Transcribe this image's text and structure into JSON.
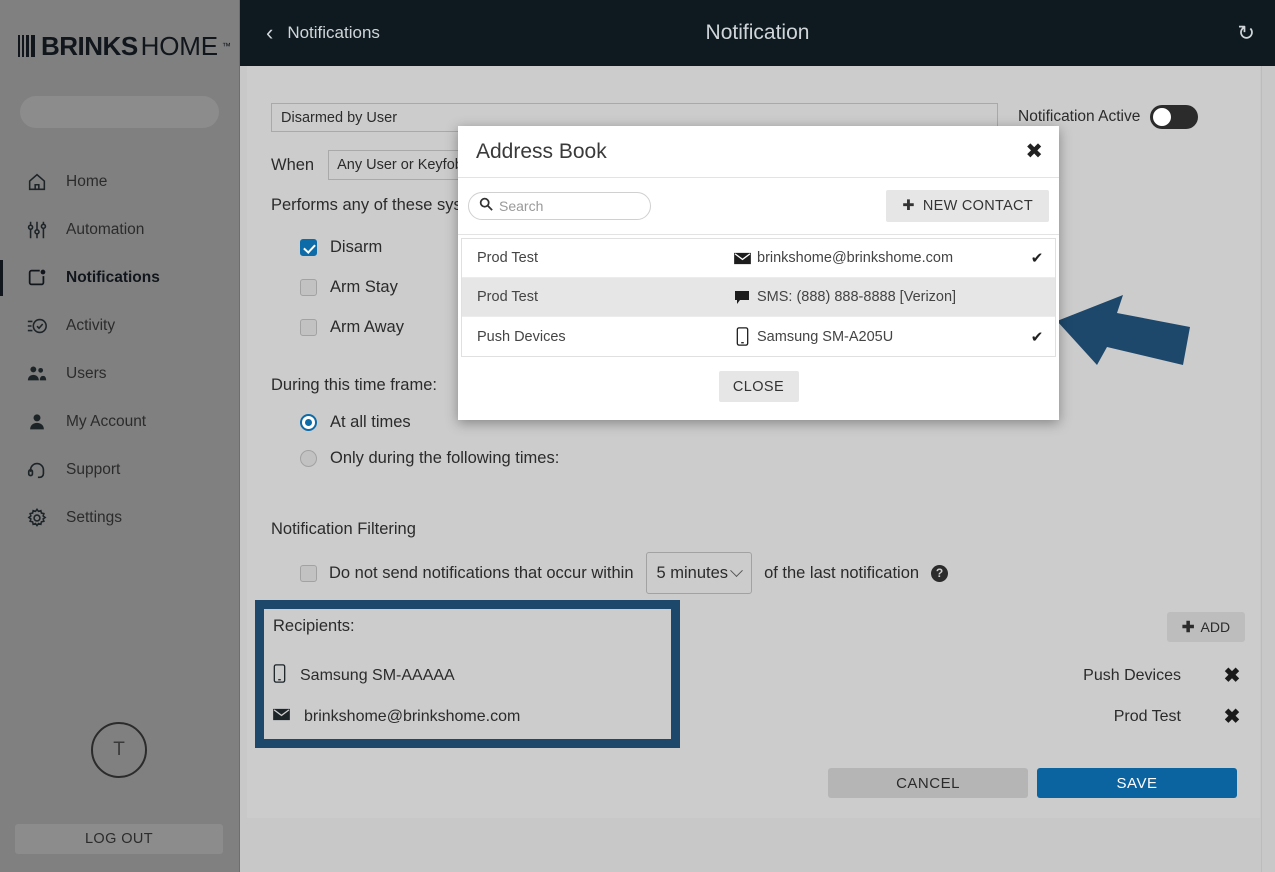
{
  "colors": {
    "sidebar_bg": "#808080",
    "header_bg": "#0e1a20",
    "panel_bg": "#cccccc",
    "accent_blue": "#0b639f",
    "checkbox_blue": "#0d6ba8",
    "annotation_navy": "#1e486b"
  },
  "sidebar": {
    "logo": {
      "brand": "BRINKS",
      "product": "HOME",
      "trademark": "™"
    },
    "items": [
      {
        "label": "Home",
        "icon": "home-icon",
        "active": false
      },
      {
        "label": "Automation",
        "icon": "sliders-icon",
        "active": false
      },
      {
        "label": "Notifications",
        "icon": "notification-icon",
        "active": true
      },
      {
        "label": "Activity",
        "icon": "activity-check-icon",
        "active": false
      },
      {
        "label": "Users",
        "icon": "users-icon",
        "active": false
      },
      {
        "label": "My Account",
        "icon": "person-icon",
        "active": false
      },
      {
        "label": "Support",
        "icon": "headset-icon",
        "active": false
      },
      {
        "label": "Settings",
        "icon": "gear-icon",
        "active": false
      }
    ],
    "avatar_initial": "T",
    "logout_label": "LOG OUT"
  },
  "header": {
    "back_label": "Notifications",
    "title": "Notification",
    "back_icon": "chevron-left-icon",
    "refresh_icon": "refresh-icon"
  },
  "form": {
    "name_value": "Disarmed by User",
    "toggle_label": "Notification Active",
    "toggle_state": "off",
    "when_label": "When",
    "when_value": "Any User or Keyfob",
    "performs_label": "Performs any of these system actions:",
    "actions": [
      {
        "label": "Disarm",
        "checked": true
      },
      {
        "label": "Arm Stay",
        "checked": false
      },
      {
        "label": "Arm Away",
        "checked": false
      }
    ],
    "timeframe_label": "During this time frame:",
    "timeframe_options": [
      {
        "label": "At all times",
        "selected": true
      },
      {
        "label": "Only during the following times:",
        "selected": false
      }
    ],
    "filtering_label": "Notification Filtering",
    "filter_checkbox_checked": false,
    "filter_text_before": "Do not send notifications that occur within",
    "filter_interval": "5 minutes",
    "filter_text_after": "of the last notification",
    "help_icon": "help-icon"
  },
  "recipients": {
    "title": "Recipients:",
    "add_label": "ADD",
    "add_icon": "plus-icon",
    "rows": [
      {
        "icon": "mobile-icon",
        "value": "Samsung SM-AAAAA",
        "type": "Push Devices",
        "remove_icon": "close-x-icon"
      },
      {
        "icon": "envelope-icon",
        "value": "brinkshome@brinkshome.com",
        "type": "Prod Test",
        "remove_icon": "close-x-icon"
      }
    ]
  },
  "footer": {
    "cancel_label": "CANCEL",
    "save_label": "SAVE"
  },
  "modal": {
    "title": "Address Book",
    "close_icon": "close-x-icon",
    "search_placeholder": "Search",
    "search_value": "",
    "search_icon": "search-icon",
    "new_contact_label": "NEW CONTACT",
    "new_contact_icon": "plus-icon",
    "rows": [
      {
        "name": "Prod Test",
        "icon": "envelope-icon",
        "value": "brinkshome@brinkshome.com",
        "selected": true,
        "check": "✔",
        "highlighted": false
      },
      {
        "name": "Prod Test",
        "icon": "sms-icon",
        "value": "SMS: (888) 888-8888 [Verizon]",
        "selected": false,
        "check": "",
        "highlighted": true
      },
      {
        "name": "Push Devices",
        "icon": "mobile-icon",
        "value": "Samsung SM-A205U",
        "selected": true,
        "check": "✔",
        "highlighted": false
      }
    ],
    "close_button_label": "CLOSE"
  },
  "annotation": {
    "arrow": "arrow-pointing-up-left"
  }
}
